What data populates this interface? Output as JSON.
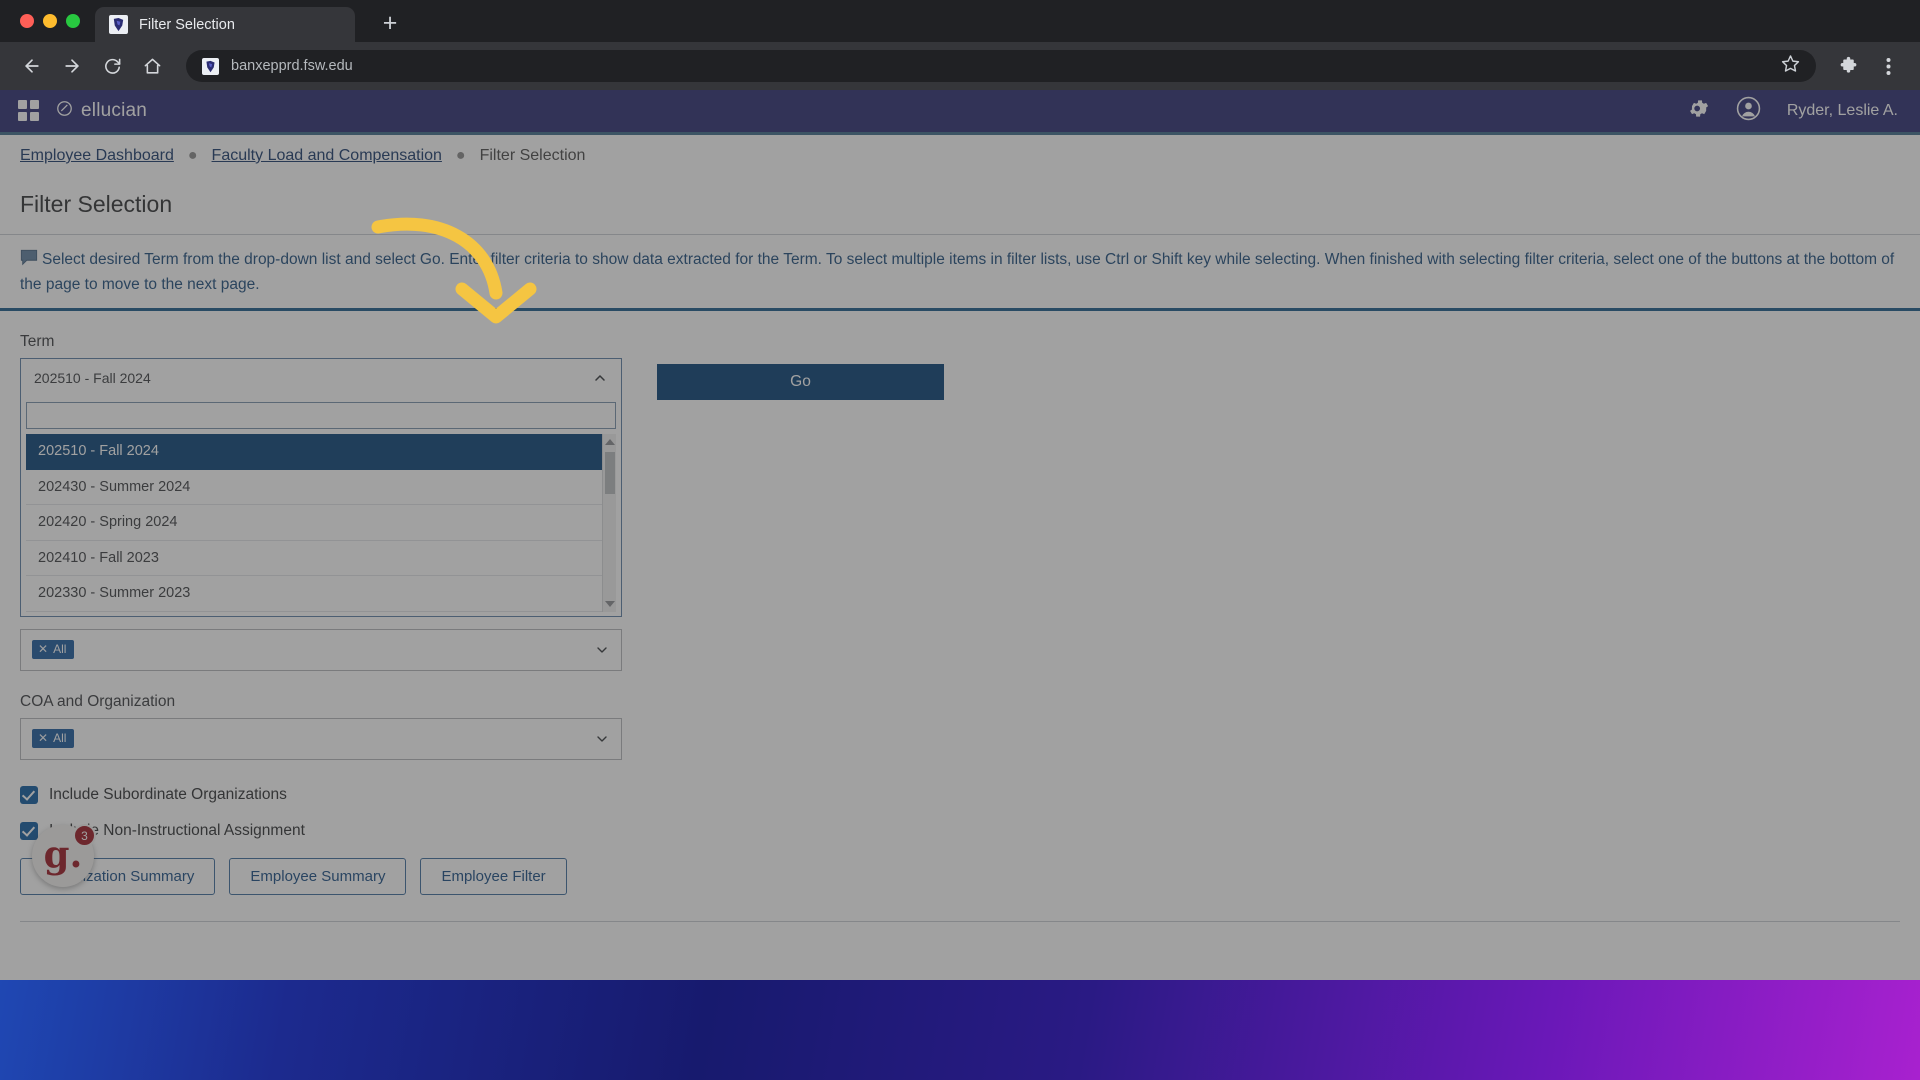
{
  "browser": {
    "tab": {
      "title": "Filter Selection",
      "favicon_icon": "ellucian-favicon"
    },
    "new_tab_label": "+",
    "back_icon": "back-arrow-icon",
    "forward_icon": "forward-arrow-icon",
    "reload_icon": "reload-icon",
    "home_icon": "home-icon",
    "url": "banxepprd.fsw.edu",
    "bookmark_icon": "star-icon",
    "extensions_icon": "puzzle-icon",
    "menu_icon": "three-dot-menu-icon",
    "traffic_lights": [
      "close-red",
      "minimize-yellow",
      "maximize-green"
    ]
  },
  "app_header": {
    "apps_grid_icon": "apps-grid-icon",
    "brand": "ellucian",
    "brand_mark_icon": "ellucian-mark-icon",
    "settings_icon": "gear-icon",
    "avatar_icon": "user-avatar-icon",
    "user_name": "Ryder, Leslie A.",
    "background_color": "#2b2d72"
  },
  "breadcrumb": {
    "items": [
      {
        "label": "Employee Dashboard",
        "is_link": true
      },
      {
        "label": "Faculty Load and Compensation",
        "is_link": true
      },
      {
        "label": "Filter Selection",
        "is_link": false
      }
    ],
    "separator": "●"
  },
  "page": {
    "title": "Filter Selection",
    "instruction_icon": "speech-bubble-icon",
    "instructions": "Select desired Term from the drop-down list and select Go. Enter filter criteria to show data extracted for the Term. To select multiple items in filter lists, use Ctrl or Shift key while selecting. When finished with selecting filter criteria, select one of the buttons at the bottom of the page to move to the next page.",
    "accent_color": "#1a5a8a"
  },
  "form": {
    "term": {
      "label": "Term",
      "selected_value": "202510 - Fall 2024",
      "expanded": true,
      "caret_icon": "chevron-up-icon",
      "search_placeholder": "",
      "search_value": "",
      "options": [
        "202510 - Fall 2024",
        "202430 - Summer 2024",
        "202420 - Spring 2024",
        "202410 - Fall 2023",
        "202330 - Summer 2023"
      ],
      "selected_index": 0,
      "scroll_up_icon": "scroll-up-arrow-icon",
      "scroll_down_icon": "scroll-down-arrow-icon"
    },
    "go_button": "Go",
    "hidden_field": {
      "chip": "All",
      "chip_remove_icon": "chip-remove-x-icon",
      "caret_icon": "chevron-down-icon"
    },
    "coa": {
      "label": "COA and Organization",
      "chip": "All",
      "chip_remove_icon": "chip-remove-x-icon",
      "caret_icon": "chevron-down-icon"
    },
    "checkboxes": [
      {
        "label": "Include Subordinate Organizations",
        "checked": true
      },
      {
        "label": "Include Non-Instructional Assignment",
        "checked": true
      }
    ],
    "action_buttons": [
      "Organization Summary",
      "Employee Summary",
      "Employee Filter"
    ]
  },
  "help_widget": {
    "logo_text": "g.",
    "badge_count": "3",
    "badge_color": "#9c1621"
  },
  "annotation": {
    "type": "curved-down-arrow",
    "color": "#f5c542"
  },
  "desktop": {
    "wallpaper_colors": [
      "#2159c9",
      "#171a6e",
      "#a821cf"
    ]
  }
}
